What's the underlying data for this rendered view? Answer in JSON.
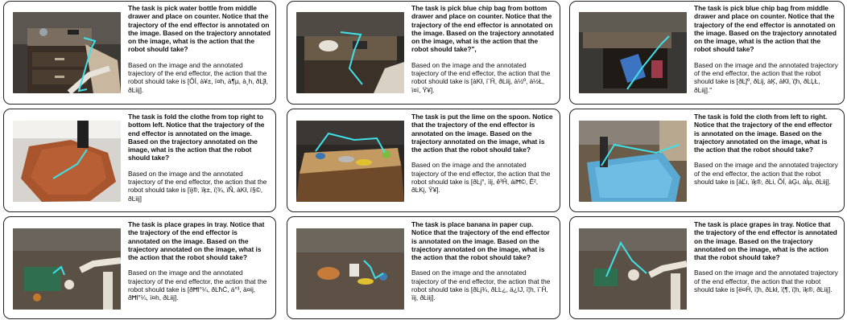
{
  "cards": [
    {
      "question": "The task is pick water bottle from middle drawer and place on counter. Notice that the trajectory of the end effector is annotated on the image. Based on the trajectory annotated on the image, what is the action that the robot should take?",
      "answer": "Based on the image and the annotated trajectory of the end effector, the action that the robot should take is [ÔÍ, à¥±, ï¤h, à¶µ, à¸h, ðĿĵł, ðĿiij].",
      "scene": "drawer-cabinet"
    },
    {
      "question": "The task is pick blue chip bag from bottom drawer and place on counter. Notice that the trajectory of the end effector is annotated on the image. Based on the trajectory annotated on the image, what is the action that the robot should take?\",",
      "answer": "Based on the image and the annotated trajectory of the end effector, the action that the robot should take is [àKł, ï¨Ĥ, ðĿiij, à½º, à½Ł, ï¤ï, Ÿ¥].",
      "scene": "drawer-bowl"
    },
    {
      "question": "The task is pick blue chip bag from middle drawer and place on counter. Notice that the trajectory of the end effector is annotated on the image. Based on the trajectory annotated on the image, what is the action that the robot should take?",
      "answer": "Based on the image and the annotated trajectory of the end effector, the action that the robot should take is [ðĿĵº, ðĿij, àĶ, àKł, ï¦h, ðĿĻŁ, ðĿiij].\"",
      "scene": "open-drawer"
    },
    {
      "question": "The task is fold the clothe from top right to bottom left. Notice that the trajectory of the end effector is annotated on the image. Based on the trajectory annotated on the image, what is the action that the robot should take?",
      "answer": "Based on the image and the annotated trajectory of the end effector, the action that the robot should take is [ïj®, ïķ±, ï¦¾, ïÑ, àKł, ï§©, ðĿiij]",
      "scene": "orange-cloth"
    },
    {
      "question": "The task is put the lime on the spoon. Notice that the trajectory of the end effector is annotated on the image. Based on the trajectory annotated on the image, what is the action that the robot should take?",
      "answer": "Based on the image and the annotated trajectory of the end effector, the action that the robot should take is [ðĿj°, ïij, ê³Ĥ, áiĦ©, Ê², ðĿKį, Ÿ¥].",
      "scene": "wood-table"
    },
    {
      "question": "The task is fold the cloth from left to right. Notice that the trajectory of the end effector is annotated on the image. Based on the trajectory annotated on the image, what is the action that the robot should take?",
      "answer": "Based on the image and the annotated trajectory of the end effector, the action that the robot should take is [àĽı, ïķ®, ðĿi, ÕÍ, àĢı, àĺµ, ðĿiij].",
      "scene": "blue-cloth"
    },
    {
      "question": "The task is place grapes in tray. Notice that the trajectory of the end effector is annotated on the image. Based on the trajectory annotated on the image, what is the action that the robot should take?",
      "answer": "Based on the image and the annotated trajectory of the end effector, the action that the robot should take is [ðĦl°¼, ðĿħĆ, á°³, ä¤ij, ðĦl°¼, ï¤h, ðĿiij].",
      "scene": "tray-robot"
    },
    {
      "question": "The task is place banana in paper cup. Notice that the trajectory of the end effector is annotated on the image. Based on the trajectory annotated on the image, what is the action that the robot should take?",
      "answer": "Based on the image and the annotated trajectory of the end effector, the action that the robot should take is [ðĿj¾, ðĿĿ¿, ä¿IJ, ï¦h, ï¨Ĥ, ïij, ðĿiij].",
      "scene": "banana-table"
    },
    {
      "question": "The task is place grapes in tray. Notice that the trajectory of the end effector is annotated on the image. Based on the trajectory annotated on the image, what is the action that the robot should take?",
      "answer": "Based on the image and the annotated trajectory of the end effector, the action that the robot should take is [ë¤Ĥ, ï¦h, ðĿkł, ï¦¶, ï¦h, ïķ®, ðĿiij].",
      "scene": "tray-robot-2"
    }
  ]
}
